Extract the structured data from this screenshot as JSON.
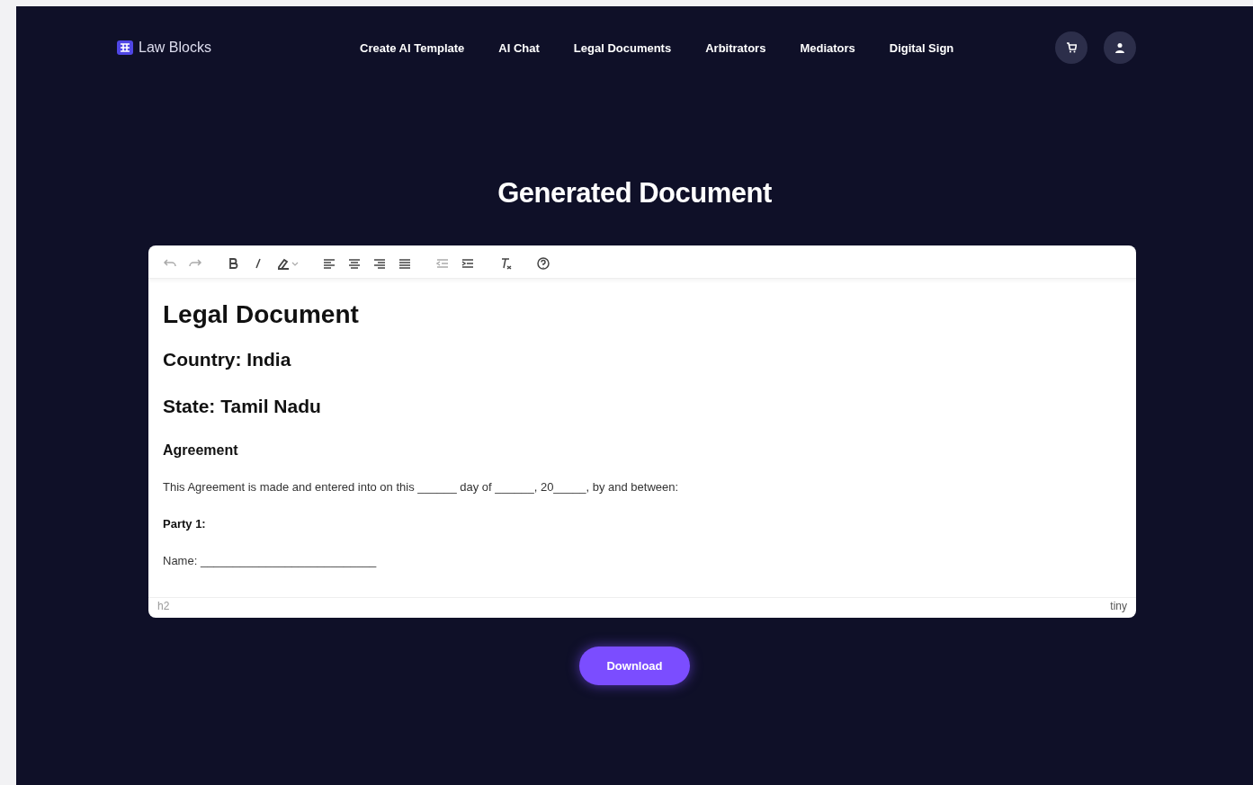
{
  "brand": {
    "name": "Law Blocks"
  },
  "nav": [
    "Create AI Template",
    "AI Chat",
    "Legal Documents",
    "Arbitrators",
    "Mediators",
    "Digital Sign"
  ],
  "page_title": "Generated Document",
  "editor": {
    "toolbar": [
      {
        "kind": "undo"
      },
      {
        "kind": "redo"
      },
      {
        "kind": "bold"
      },
      {
        "kind": "italic"
      },
      {
        "kind": "highlight"
      },
      {
        "kind": "align-left"
      },
      {
        "kind": "align-center"
      },
      {
        "kind": "align-right"
      },
      {
        "kind": "justify"
      },
      {
        "kind": "outdent"
      },
      {
        "kind": "indent"
      },
      {
        "kind": "clear-format"
      },
      {
        "kind": "help"
      }
    ],
    "content": [
      {
        "kind": "h1",
        "text": "Legal Document"
      },
      {
        "kind": "h2",
        "text": "Country: India"
      },
      {
        "kind": "h2",
        "text": "State: Tamil Nadu"
      },
      {
        "kind": "h3",
        "text": "Agreement"
      },
      {
        "kind": "p",
        "text": "This Agreement is made and entered into on this ______ day of ______, 20_____, by and between:"
      },
      {
        "kind": "h4",
        "text": "Party 1:"
      },
      {
        "kind": "p",
        "text": "Name: ___________________________"
      }
    ],
    "path": "h2",
    "branding": "tiny"
  },
  "download_button": "Download"
}
